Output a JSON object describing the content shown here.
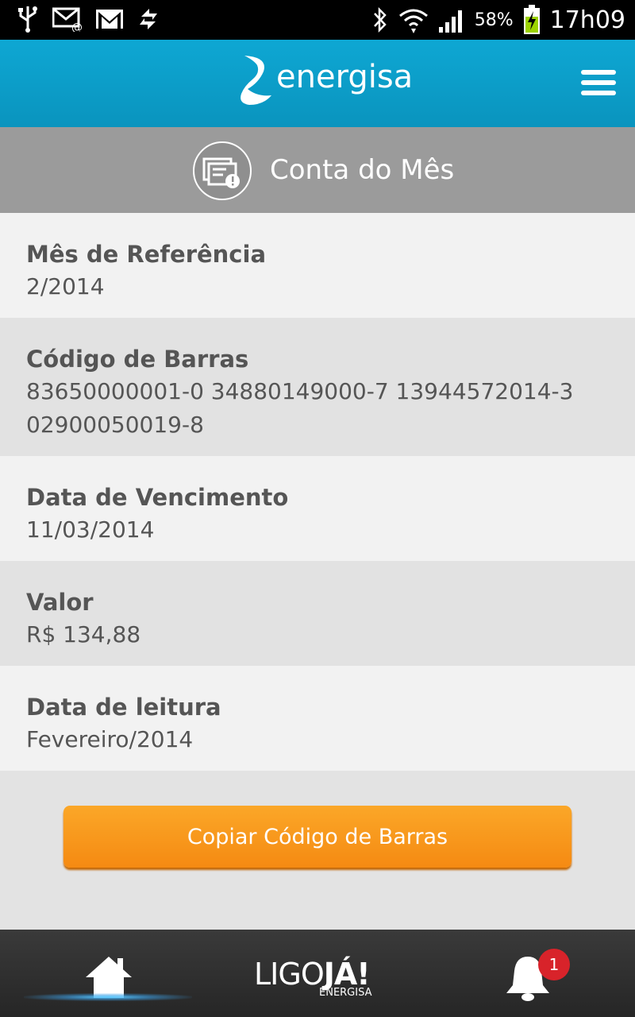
{
  "status_bar": {
    "battery_percent": "58%",
    "time": "17h09",
    "icons": [
      "usb-icon",
      "email-icon",
      "gmail-icon",
      "sync-icon",
      "bluetooth-icon",
      "wifi-icon",
      "signal-icon",
      "battery-charging-icon"
    ]
  },
  "header": {
    "logo_text": "energisa",
    "menu_icon": "hamburger-menu-icon"
  },
  "section": {
    "title": "Conta do Mês",
    "icon": "bill-icon"
  },
  "bill": {
    "rows": [
      {
        "label": "Mês de Referência",
        "value": "2/2014"
      },
      {
        "label": "Código de Barras",
        "value_line1": "83650000001-0 34880149000-7 13944572014-3",
        "value_line2": "02900050019-8"
      },
      {
        "label": "Data de Vencimento",
        "value": "11/03/2014"
      },
      {
        "label": "Valor",
        "value": "R$ 134,88"
      },
      {
        "label": "Data de leitura",
        "value": "Fevereiro/2014"
      }
    ]
  },
  "actions": {
    "copy_barcode_label": "Copiar Código de Barras"
  },
  "bottom_nav": {
    "ligo_main": "LIGO",
    "ligo_ja": "JÁ!",
    "ligo_sub": "ENERGISA",
    "notification_count": "1"
  },
  "colors": {
    "header": "#0ea7d3",
    "button": "#f7941d",
    "badge": "#d8232a"
  }
}
